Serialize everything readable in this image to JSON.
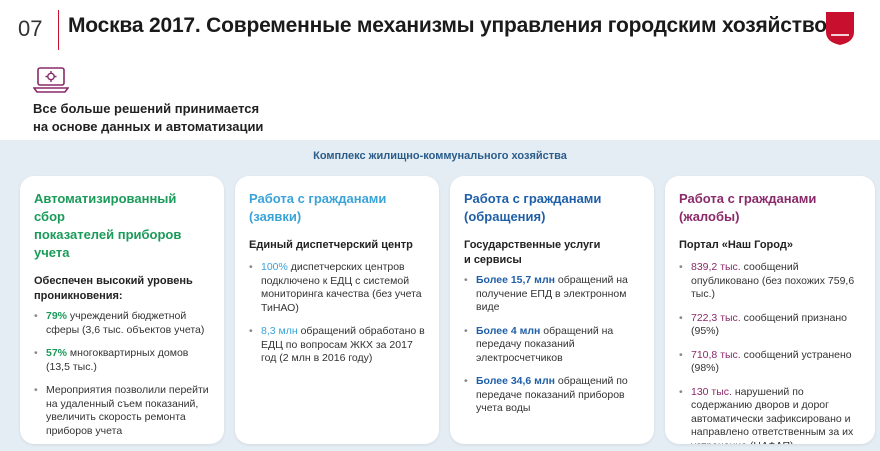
{
  "header": {
    "page_number": "07",
    "title": "Москва 2017. Современные механизмы управления городским хозяйством"
  },
  "intro": {
    "line1": "Все больше решений принимается",
    "line2": "на основе данных и автоматизации"
  },
  "section_title": "Комплекс жилищно-коммунального хозяйства",
  "cards": [
    {
      "title_line1": "Автоматизированный сбор",
      "title_line2": "показателей приборов учета",
      "subtitle_line1": "Обеспечен высокий уровень",
      "subtitle_line2": "проникновения:",
      "items": [
        {
          "highlight": "79%",
          "text": " учреждений бюджетной сферы (3,6 тыс. объектов учета)"
        },
        {
          "highlight": "57%",
          "text": " многоквартирных домов (13,5 тыс.)"
        },
        {
          "highlight": "",
          "text": "Мероприятия позволили перейти на удаленный съем показаний, увеличить скорость ремонта приборов учета"
        }
      ]
    },
    {
      "title_line1": "Работа с гражданами",
      "title_line2": "(заявки)",
      "subtitle_line1": "Единый диспетчерский центр",
      "subtitle_line2": "",
      "items": [
        {
          "highlight": "100%",
          "text": " диспетчерских центров подключено к ЕДЦ с системой мониторинга качества (без учета ТиНАО)"
        },
        {
          "highlight": "8,3 млн",
          "text": " обращений обработано в ЕДЦ по вопросам ЖКХ за 2017 год (2 млн в 2016 году)"
        }
      ]
    },
    {
      "title_line1": "Работа с гражданами",
      "title_line2": "(обращения)",
      "subtitle_line1": "Государственные услуги",
      "subtitle_line2": "и сервисы",
      "items": [
        {
          "highlight": "Более 15,7 млн",
          "text": " обращений на получение ЕПД в электронном виде"
        },
        {
          "highlight": "Более 4 млн",
          "text": " обращений на передачу показаний электросчетчиков"
        },
        {
          "highlight": "Более 34,6 млн",
          "text": " обращений по передаче показаний приборов учета воды"
        }
      ]
    },
    {
      "title_line1": "Работа с гражданами",
      "title_line2": "(жалобы)",
      "subtitle_line1": "Портал «Наш Город»",
      "subtitle_line2": "",
      "items": [
        {
          "highlight": "839,2 тыс.",
          "text": " сообщений опубликовано (без похожих 759,6 тыс.)"
        },
        {
          "highlight": "722,3 тыс.",
          "text": " сообщений признано (95%)"
        },
        {
          "highlight": "710,8 тыс.",
          "text": " сообщений устранено (98%)"
        },
        {
          "highlight": "130 тыс.",
          "text": " нарушений по содержанию дворов и дорог автоматически зафиксировано и направлено ответ­ственным за их устранение (ЦАФАП)"
        }
      ]
    }
  ],
  "colors": {
    "accent_red": "#c8102e",
    "card1": "#1a9b5a",
    "card2": "#3aa3d8",
    "card3": "#1f5fa8",
    "card4": "#8a2a6a",
    "band": "#e4edf4"
  },
  "icons": {
    "logo": "moscow-coat-of-arms",
    "intro": "laptop-gear-icon"
  }
}
